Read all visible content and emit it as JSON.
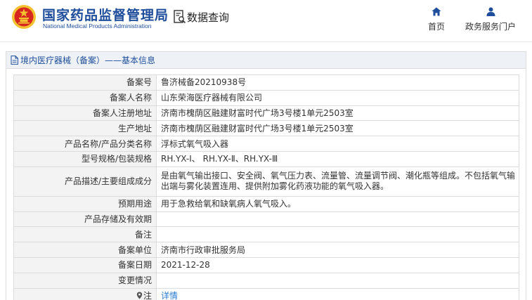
{
  "header": {
    "agency_name_cn": "国家药品监督管理局",
    "agency_name_en": "National Medical Products Administration",
    "page_title": "数据查询",
    "nav": [
      {
        "label": "首页",
        "icon": "home-icon"
      },
      {
        "label": "政务服务门户",
        "icon": "user-icon"
      }
    ]
  },
  "section": {
    "title": "境内医疗器械（备案）——基本信息"
  },
  "record": [
    {
      "label": "备案号",
      "value": "鲁济械备20210938号"
    },
    {
      "label": "备案人名称",
      "value": "山东荣海医疗器械有限公司"
    },
    {
      "label": "备案人注册地址",
      "value": "济南市槐荫区融建财富时代广场3号楼1单元2503室"
    },
    {
      "label": "生产地址",
      "value": "济南市槐荫区融建财富时代广场3号楼1单元2503室"
    },
    {
      "label": "产品名称/产品分类名称",
      "value": "浮标式氧气吸入器"
    },
    {
      "label": "型号规格/包装规格",
      "value": "RH.YX-Ⅰ、 RH.YX-Ⅱ、RH.YX-Ⅲ"
    },
    {
      "label": "产品描述/主要组成成分",
      "value": "是由氧气输出接口、安全阀、氧气压力表、流量管、流量调节阀、潮化瓶等组成。不包括氧气输出端与雾化装置连用、提供附加雾化药液功能的氧气吸入器。"
    },
    {
      "label": "预期用途",
      "value": "用于急救给氧和缺氧病人氧气吸入。"
    },
    {
      "label": "产品存储及有效期",
      "value": ""
    },
    {
      "label": "备注",
      "value": ""
    },
    {
      "label": "备案单位",
      "value": "济南市行政审批服务局"
    },
    {
      "label": "备案日期",
      "value": "2021-12-28"
    },
    {
      "label": "变更情况",
      "value": ""
    },
    {
      "label": "注",
      "value": "详情"
    }
  ],
  "colors": {
    "brand_blue": "#1e4d9b",
    "emblem_red": "#d7261e",
    "emblem_gold": "#f2c230",
    "link_blue": "#2a7bd3",
    "label_bg": "#f3f3f3",
    "border": "#dcdcdc"
  }
}
